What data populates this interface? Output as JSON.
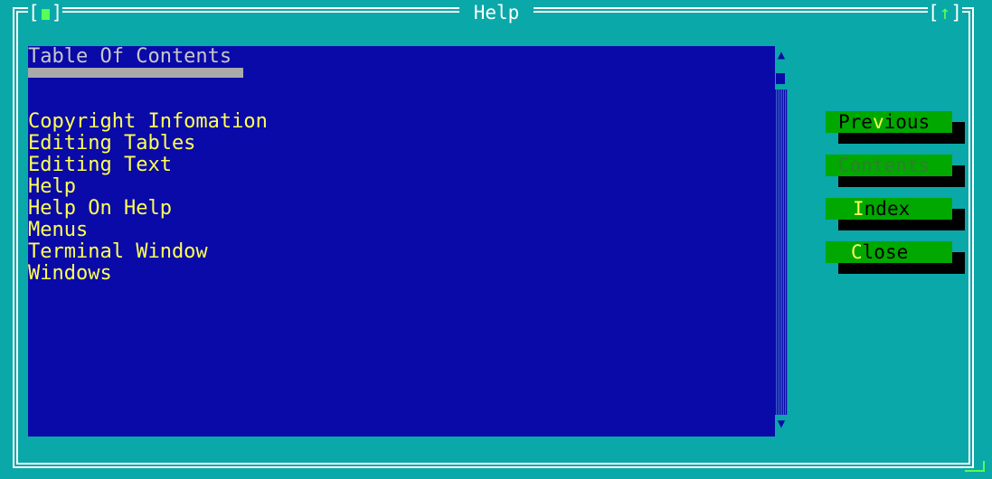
{
  "window": {
    "title": "Help",
    "close_left": "[",
    "close_right": "]",
    "zoom_left": "[",
    "zoom_arrow": "↑",
    "zoom_right": "]"
  },
  "content": {
    "heading": "Table Of Contents",
    "topics": [
      "Copyright Infomation",
      "Editing Tables",
      "Editing Text",
      "Help",
      "Help On Help",
      "Menus",
      "Terminal Window",
      "Windows"
    ]
  },
  "scrollbar": {
    "up_arrow": "▲",
    "down_arrow": "▼"
  },
  "buttons": {
    "previous": {
      "pre": "Pre",
      "hot": "v",
      "post": "ious"
    },
    "contents": {
      "label": "Contents"
    },
    "index": {
      "pre": "",
      "hot": "I",
      "post": "ndex"
    },
    "close": {
      "pre": "",
      "hot": "C",
      "post": "lose"
    }
  },
  "colors": {
    "desktop": "#0aa8a8",
    "content_bg": "#0a0aa8",
    "topic_text": "#ffff55",
    "button_bg": "#00a800",
    "hotkey": "#ffff55"
  }
}
